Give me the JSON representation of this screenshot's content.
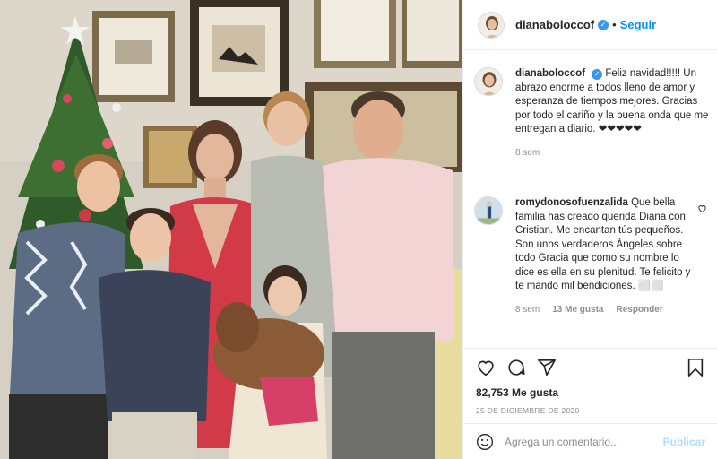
{
  "post": {
    "username": "dianaboloccof",
    "follow_label": "Seguir",
    "dot": "•",
    "verified_mark": "✓"
  },
  "comments": [
    {
      "username": "dianaboloccof",
      "text": "Feliz navidad!!!!! Un abrazo enorme a todos lleno de amor y esperanza de tiempos mejores. Gracias por todo el cariño y la buena onda que me entregan a diario. ❤❤❤❤❤",
      "time": "8 sem",
      "verified": true
    },
    {
      "username": "romydonosofuenzalida",
      "text": "Que bella familia has creado querida Diana con Cristian. Me encantan tús pequeños. Son unos verdaderos Ángeles sobre todo Gracia que como su nombre lo dice es ella en su plenitud. Te felicito y te mando mil bendiciones. ⬜⬜",
      "time": "8 sem",
      "likes": "13 Me gusta",
      "reply_label": "Responder"
    }
  ],
  "likes_text": "82,753 Me gusta",
  "date_text": "25 DE DICIEMBRE DE 2020",
  "add_comment": {
    "placeholder": "Agrega un comentario...",
    "publish_label": "Publicar"
  },
  "icons": {
    "like": "heart-icon",
    "comment": "comment-icon",
    "share": "share-icon",
    "save": "bookmark-icon",
    "emoji": "emoji-icon",
    "comment_like": "heart-icon"
  },
  "colors": {
    "link": "#0095f6",
    "verified": "#3897f0",
    "secondary_text": "#8e8e8e",
    "publish_disabled": "#b2dffc"
  }
}
